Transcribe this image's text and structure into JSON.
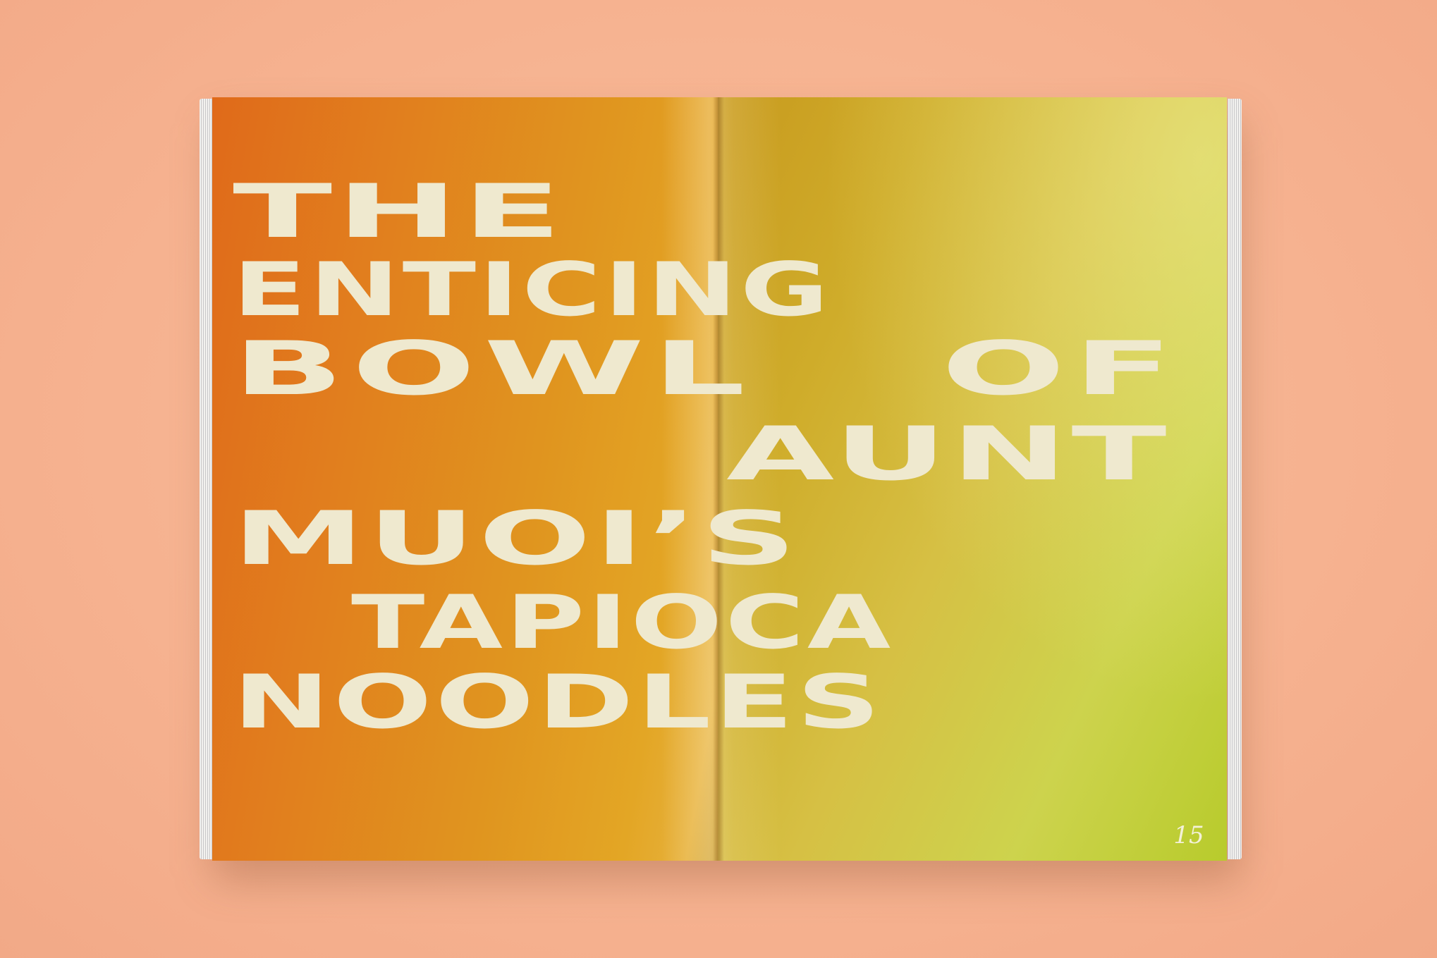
{
  "magazine": {
    "headline": {
      "line1": "THE",
      "line2": "ENTICING",
      "line3a": "BOWL",
      "line3b": "OF",
      "line4": "AUNT",
      "line5": "MUOI’S",
      "line6": "TAPIOCA",
      "line7": "NOODLES"
    },
    "page_number": "15"
  },
  "colors": {
    "background": "#f7b592",
    "headline_text": "#efe9cf",
    "left_page_start": "#e06a1a",
    "right_page_end": "#b8cb2c"
  }
}
